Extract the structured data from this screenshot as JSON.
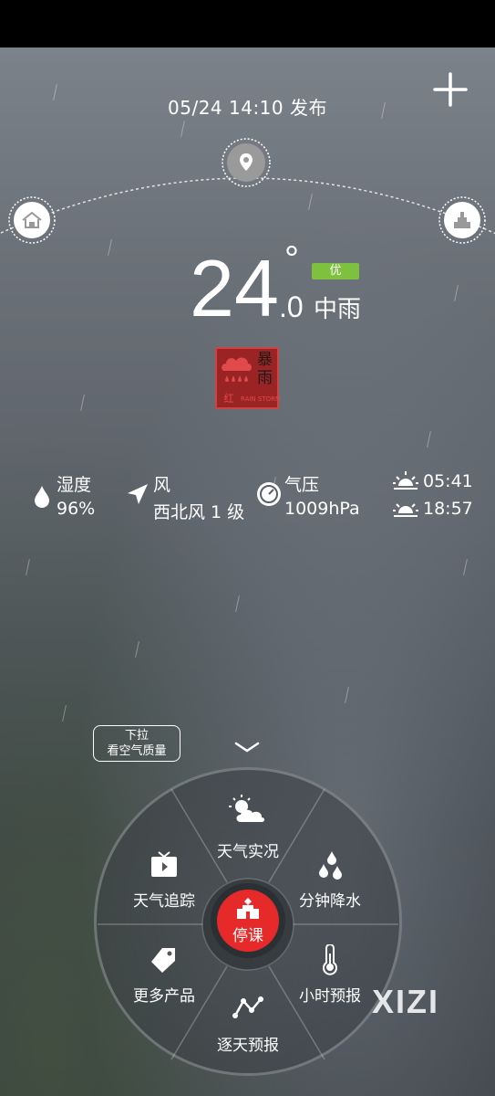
{
  "header": {
    "publish_time": "05/24  14:10 发布"
  },
  "current": {
    "temp_int": "24",
    "temp_deg": "°",
    "temp_dec": ".0",
    "condition": "中雨",
    "aqi": "优"
  },
  "alert": {
    "top": "暴",
    "bottom": "雨",
    "level": "红",
    "en": "RAIN STORM"
  },
  "details": {
    "humidity_label": "湿度",
    "humidity_value": "96%",
    "wind_label": "风",
    "wind_value": "西北风 1 级",
    "pressure_label": "气压",
    "pressure_value": "1009hPa",
    "sunrise": "05:41",
    "sunset": "18:57"
  },
  "tooltip": {
    "line1": "下拉",
    "line2": "看空气质量"
  },
  "wheel": {
    "items": [
      "天气实况",
      "分钟降水",
      "小时预报",
      "逐天预报",
      "更多产品",
      "天气追踪"
    ],
    "center": "停课"
  },
  "watermark": "XIZI",
  "colors": {
    "aqi_good": "#7ec13f",
    "alert_red": "#9a2424",
    "center_red": "#e62a2a"
  },
  "icons": [
    "menu-icon",
    "add-icon",
    "home-location-icon",
    "gps-location-icon",
    "landmark-location-icon",
    "raindrop-icon",
    "wind-arrow-icon",
    "gauge-icon",
    "sunrise-icon",
    "sunset-icon",
    "chevron-down-icon"
  ]
}
